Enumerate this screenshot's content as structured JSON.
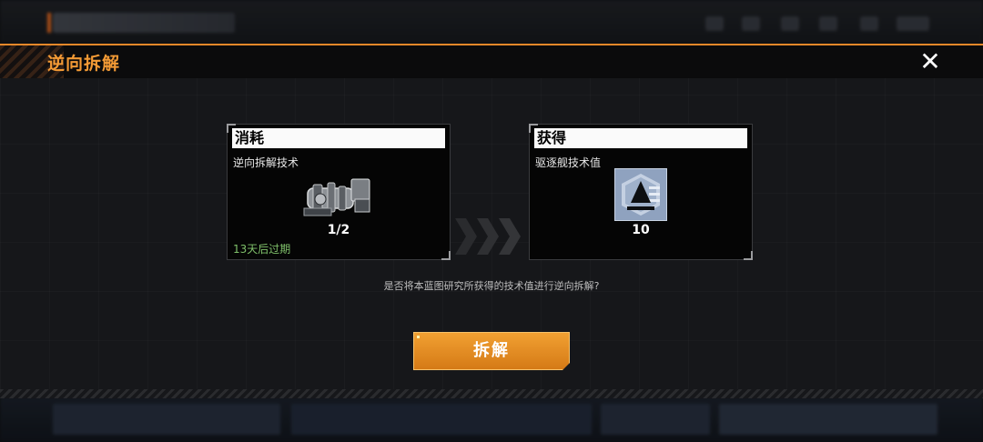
{
  "modal": {
    "title": "逆向拆解",
    "close_icon": "close-icon"
  },
  "consume_card": {
    "header": "消耗",
    "item_name": "逆向拆解技术",
    "count": "1/2",
    "expiry": "13天后过期",
    "icon": "machine-part-icon"
  },
  "gain_card": {
    "header": "获得",
    "item_name": "驱逐舰技术值",
    "count": "10",
    "icon": "tech-value-icon"
  },
  "question": "是否将本蓝图研究所获得的技术值进行逆向拆解?",
  "confirm_button": {
    "label": "拆解"
  },
  "colors": {
    "accent": "#f39a35",
    "button": "#e08a22",
    "expiry": "#7fc06a"
  }
}
